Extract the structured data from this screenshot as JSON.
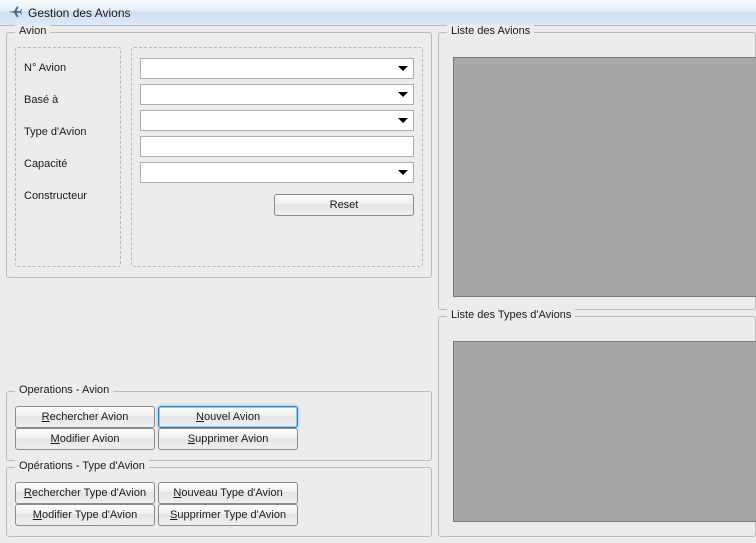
{
  "window": {
    "title": "Gestion des Avions"
  },
  "avion": {
    "legend": "Avion",
    "labels": {
      "num": "N° Avion",
      "base": "Basé à",
      "type": "Type d'Avion",
      "capacite": "Capacité",
      "constructeur": "Constructeur"
    },
    "values": {
      "num": "",
      "base": "",
      "type": "",
      "capacite": "",
      "constructeur": ""
    },
    "reset_label": "Reset"
  },
  "ops_avion": {
    "legend": "Operations - Avion",
    "rechercher": "Rechercher Avion",
    "nouvel": "Nouvel Avion",
    "modifier": "Modifier Avion",
    "supprimer": "Supprimer Avion"
  },
  "ops_type": {
    "legend": "Opérations - Type d'Avion",
    "rechercher": "Rechercher Type d'Avion",
    "nouveau": "Nouveau Type d'Avion",
    "modifier": "Modifier Type d'Avion",
    "supprimer": "Supprimer Type d'Avion"
  },
  "lists": {
    "avions_legend": "Liste des Avions",
    "types_legend": "Liste des Types d'Avions"
  }
}
